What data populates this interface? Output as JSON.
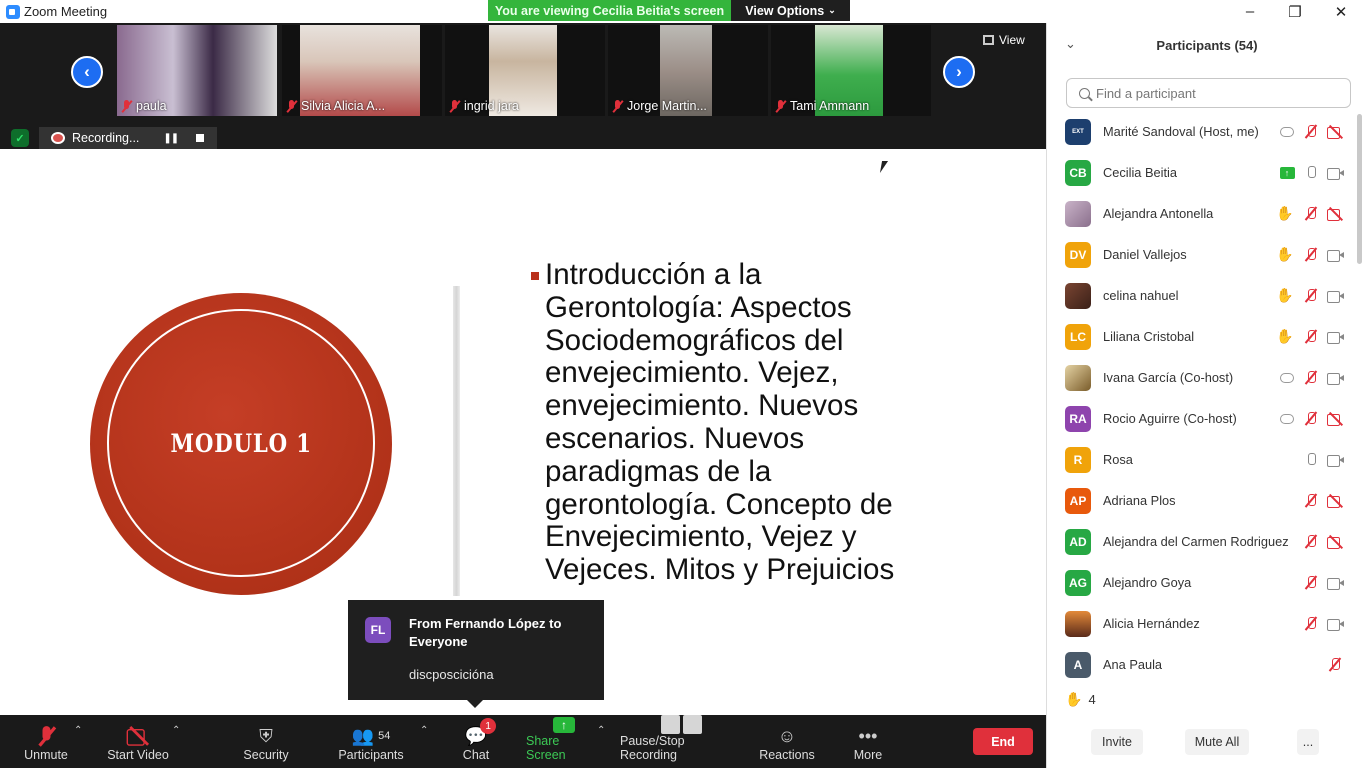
{
  "window": {
    "title": "Zoom Meeting",
    "banner": "You are viewing Cecilia Beitia's screen",
    "view_options": "View Options"
  },
  "gallery": {
    "view_label": "View",
    "tiles": [
      {
        "name": "paula"
      },
      {
        "name": "Silvia Alicia A..."
      },
      {
        "name": "ingrid jara"
      },
      {
        "name": "Jorge Martin..."
      },
      {
        "name": "Tami Ammann"
      }
    ],
    "recording_label": "Recording..."
  },
  "slide": {
    "badge_text": "MODULO 1",
    "body": "Introducción a la Gerontología: Aspectos Sociodemográficos del envejecimiento. Vejez, envejecimiento. Nuevos escenarios. Nuevos paradigmas de la gerontología. Concepto de Envejecimiento, Vejez y Vejeces. Mitos y Prejuicios"
  },
  "chat_toast": {
    "initials": "FL",
    "title": "From Fernando López to Everyone",
    "message": "discposcicióna"
  },
  "toolbar": {
    "unmute": "Unmute",
    "start_video": "Start Video",
    "security": "Security",
    "participants": "Participants",
    "participants_count": "54",
    "chat": "Chat",
    "chat_badge": "1",
    "share_screen": "Share Screen",
    "pause_stop_recording": "Pause/Stop Recording",
    "reactions": "Reactions",
    "more": "More",
    "end": "End"
  },
  "panel": {
    "title": "Participants (54)",
    "search_placeholder": "Find a participant",
    "participants": [
      {
        "name": "Marité Sandoval (Host, me)",
        "initials": "",
        "color": "#1d3f6e"
      },
      {
        "name": "Cecilia Beitia",
        "initials": "CB",
        "color": "#27a844"
      },
      {
        "name": "Alejandra Antonella",
        "initials": "",
        "color": "#9a7a9e"
      },
      {
        "name": "Daniel  Vallejos",
        "initials": "DV",
        "color": "#f0a30a"
      },
      {
        "name": "celina nahuel",
        "initials": "",
        "color": "#6b3b2a"
      },
      {
        "name": "Liliana Cristobal",
        "initials": "LC",
        "color": "#f0a30a"
      },
      {
        "name": "Ivana García (Co-host)",
        "initials": "",
        "color": "#c8a04a"
      },
      {
        "name": "Rocio Aguirre (Co-host)",
        "initials": "RA",
        "color": "#8e44ad"
      },
      {
        "name": "Rosa",
        "initials": "R",
        "color": "#f0a30a"
      },
      {
        "name": "Adriana Plos",
        "initials": "AP",
        "color": "#e8590c"
      },
      {
        "name": "Alejandra del Carmen Rodriguez",
        "initials": "AD",
        "color": "#27a844"
      },
      {
        "name": "Alejandro Goya",
        "initials": "AG",
        "color": "#27a844"
      },
      {
        "name": "Alicia Hernández",
        "initials": "",
        "color": "#b5502a"
      },
      {
        "name": "Ana Paula",
        "initials": "A",
        "color": "#4a5a6a"
      }
    ],
    "raised_hands": "4",
    "invite": "Invite",
    "mute_all": "Mute All",
    "more": "..."
  }
}
